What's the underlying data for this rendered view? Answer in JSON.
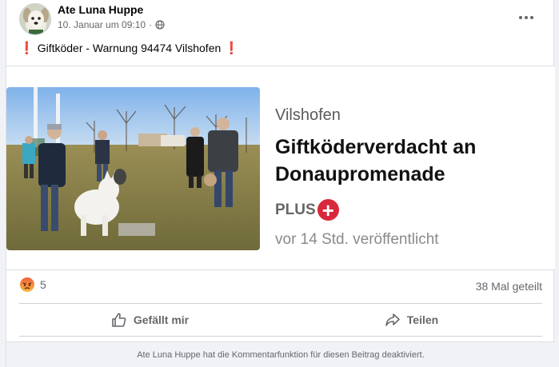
{
  "post": {
    "author": "Ate Luna Huppe",
    "timestamp": "10. Januar um 09:10",
    "separator": "·",
    "visibility_icon": "globe-icon",
    "menu_icon": "more-horizontal-icon",
    "text": "Giftköder - Warnung 94474 Vilshofen",
    "text_prefix_icon": "red-exclamation-icon",
    "text_suffix_icon": "red-exclamation-icon"
  },
  "link_card": {
    "city": "Vilshofen",
    "title": "Giftköderverdacht an Donaupromenade",
    "plus_label": "PLUS",
    "plus_symbol": "+",
    "time": "vor 14 Std. veröffentlicht",
    "image_icon": "news-photo-dogs-park"
  },
  "stats": {
    "reaction_icon": "angry-reaction-icon",
    "reaction_count": "5",
    "shares": "38 Mal geteilt"
  },
  "actions": {
    "like": "Gefällt mir",
    "like_icon": "thumbs-up-icon",
    "share": "Teilen",
    "share_icon": "share-arrow-icon"
  },
  "footer": {
    "text": "Ate Luna Huppe hat die Kommentarfunktion für diesen Beitrag deaktiviert."
  },
  "colors": {
    "accent_red": "#d8283b",
    "exclamation": "#e0245e",
    "angry": "#f15a3c",
    "secondary_text": "#65676b"
  }
}
